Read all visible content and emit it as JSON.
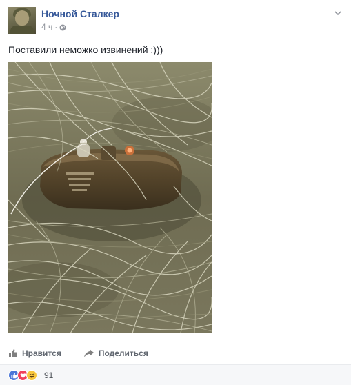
{
  "post": {
    "author": "Ночной Сталкер",
    "time": "4 ч",
    "separator": "·",
    "privacy_icon": "globe-icon",
    "menu_icon": "chevron-down-icon",
    "text": "Поставили неможко извинений :)))"
  },
  "photo": {
    "description_icon": "landmine-in-grass-photo"
  },
  "actions": {
    "like_label": "Нравится",
    "like_icon": "thumbs-up-icon",
    "share_label": "Поделиться",
    "share_icon": "share-arrow-icon"
  },
  "reactions": {
    "types": [
      "like",
      "love",
      "haha"
    ],
    "count": "91"
  },
  "colors": {
    "author_link": "#365899",
    "meta_gray": "#90949c",
    "action_gray": "#616770",
    "like_blue": "#4a76d8",
    "love_red": "#f0415b",
    "haha_yellow": "#f7c63e"
  }
}
